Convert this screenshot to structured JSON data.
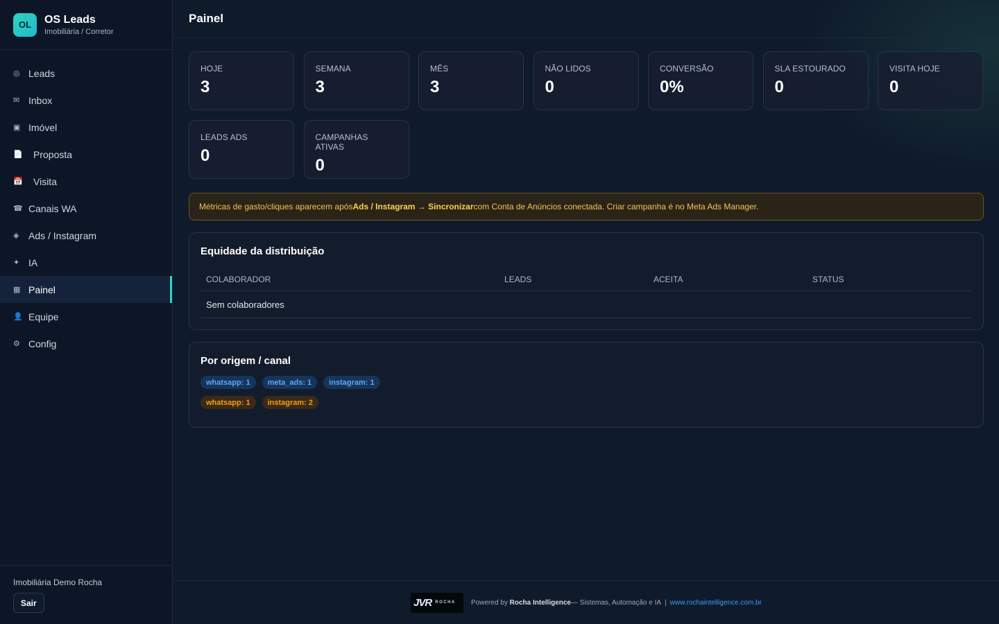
{
  "brand": {
    "logo_text": "OL",
    "title": "OS Leads",
    "subtitle": "Imobiliária / Corretor"
  },
  "nav": {
    "items": [
      {
        "label": "Leads",
        "icon": "target-icon",
        "glyph": "◎"
      },
      {
        "label": "Inbox",
        "icon": "mail-icon",
        "glyph": "✉"
      },
      {
        "label": "Imóvel",
        "icon": "building-icon",
        "glyph": "▣"
      },
      {
        "label": "Proposta",
        "icon": "document-icon",
        "glyph": "📄"
      },
      {
        "label": "Visita",
        "icon": "calendar-icon",
        "glyph": "📅"
      },
      {
        "label": "Canais WA",
        "icon": "phone-icon",
        "glyph": "☎"
      },
      {
        "label": "Ads / Instagram",
        "icon": "diamond-icon",
        "glyph": "◈"
      },
      {
        "label": "IA",
        "icon": "sparkle-icon",
        "glyph": "✦"
      },
      {
        "label": "Painel",
        "icon": "grid-icon",
        "glyph": "▦",
        "active": true
      },
      {
        "label": "Equipe",
        "icon": "person-icon",
        "glyph": "👤"
      },
      {
        "label": "Config",
        "icon": "gear-icon",
        "glyph": "⚙"
      }
    ]
  },
  "sidebar_footer": {
    "org_name": "Imobiliária Demo Rocha",
    "logout_label": "Sair"
  },
  "page": {
    "title": "Painel"
  },
  "stats": [
    {
      "label": "HOJE",
      "value": "3"
    },
    {
      "label": "SEMANA",
      "value": "3"
    },
    {
      "label": "MÊS",
      "value": "3"
    },
    {
      "label": "NÃO LIDOS",
      "value": "0"
    },
    {
      "label": "CONVERSÃO",
      "value": "0%"
    },
    {
      "label": "SLA ESTOURADO",
      "value": "0"
    },
    {
      "label": "VISITA HOJE",
      "value": "0"
    },
    {
      "label": "LEADS ADS",
      "value": "0"
    },
    {
      "label": "CAMPANHAS ATIVAS",
      "value": "0"
    }
  ],
  "notice": {
    "prefix": "Métricas de gasto/cliques aparecem após ",
    "bold1": "Ads / Instagram → Sincronizar",
    "suffix": " com Conta de Anúncios conectada. Criar campanha é no Meta Ads Manager."
  },
  "distribution": {
    "title": "Equidade da distribuição",
    "columns": [
      "COLABORADOR",
      "LEADS",
      "ACEITA",
      "STATUS"
    ],
    "empty_text": "Sem colaboradores"
  },
  "origin": {
    "title": "Por origem / canal",
    "row1": [
      "whatsapp: 1",
      "meta_ads: 1",
      "instagram: 1"
    ],
    "row2": [
      "whatsapp: 1",
      "instagram: 2"
    ]
  },
  "colors": {
    "accent": "#2dd4bf",
    "warning": "#f4c552",
    "link": "#3b9cff"
  },
  "footer": {
    "logo_text": "JVR",
    "logo_sub": "ROCHA",
    "powered_prefix": "Powered by ",
    "company": "Rocha Intelligence",
    "tagline": " — Sistemas, Automação e IA",
    "separator": "|",
    "url": "www.rochaintelligence.com.br"
  }
}
